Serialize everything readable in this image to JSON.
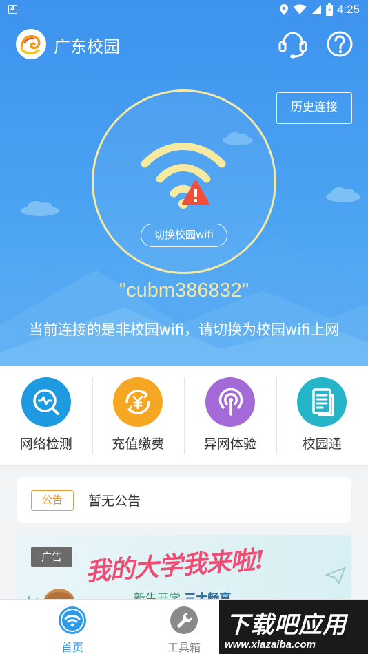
{
  "status_bar": {
    "time": "4:25",
    "app_indicator": "A"
  },
  "header": {
    "title": "广东校园",
    "service_icon": "customer-service-icon",
    "help_icon": "help-icon"
  },
  "hero": {
    "history_button": "历史连接",
    "switch_button": "切换校园wifi",
    "ssid": "\"cubm386832\"",
    "notice": "当前连接的是非校园wifi，请切换为校园wifi上网",
    "ring_color": "#f6eaa3"
  },
  "features": [
    {
      "label": "网络检测",
      "icon": "network-check-icon",
      "color": "#1e9be0"
    },
    {
      "label": "充值缴费",
      "icon": "recharge-icon",
      "color": "#f5a623"
    },
    {
      "label": "异网体验",
      "icon": "signal-icon",
      "color": "#a36ad8"
    },
    {
      "label": "校园通",
      "icon": "document-icon",
      "color": "#26b4c8"
    }
  ],
  "announcement": {
    "tag": "公告",
    "text": "暂无公告"
  },
  "banner": {
    "tag": "广告",
    "title": "我的大学我来啦!",
    "subtitle_prefix": "新生开学",
    "subtitle_highlight": "三大畅享"
  },
  "bottom_nav": [
    {
      "label": "首页",
      "active": true,
      "color": "#2d9bea"
    },
    {
      "label": "工具箱",
      "active": false,
      "color": "#888888"
    }
  ],
  "watermark": {
    "main": "下载吧应用",
    "url": "www.xiazaiba.com"
  }
}
